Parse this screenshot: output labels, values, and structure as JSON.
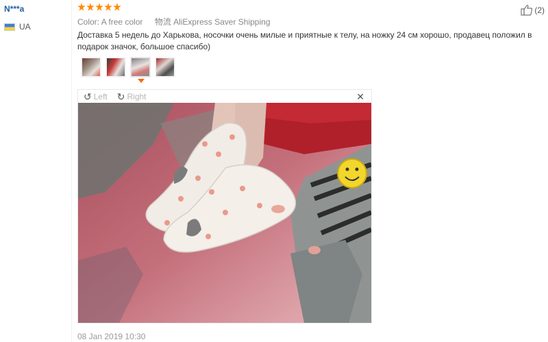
{
  "user": {
    "name": "N***a",
    "country": "UA"
  },
  "review": {
    "rating": 5,
    "color_label": "Color:",
    "color_value": "A free color",
    "shipping_from": "物流",
    "shipping": "AliExpress Saver Shipping",
    "helpful_count": "(2)",
    "text": "Доставка 5 недель до Харькова, носочки очень милые и приятные к телу, на ножку 24 см хорошо, продавец положил в подарок значок, большое спасибо)",
    "date": "08 Jan 2019 10:30"
  },
  "gallery": {
    "thumbnail_count": 4,
    "active_index": 2,
    "rotate_left": "Left",
    "rotate_right": "Right",
    "close": "✕"
  },
  "icons": {
    "star": "star-icon",
    "helpful": "thumbs-up-icon",
    "rotate_left": "rotate-left-icon",
    "rotate_right": "rotate-right-icon",
    "close": "close-icon"
  },
  "colors": {
    "star": "#ff8a00",
    "username": "#1f5fa8",
    "active_arrow": "#ff6a00"
  }
}
